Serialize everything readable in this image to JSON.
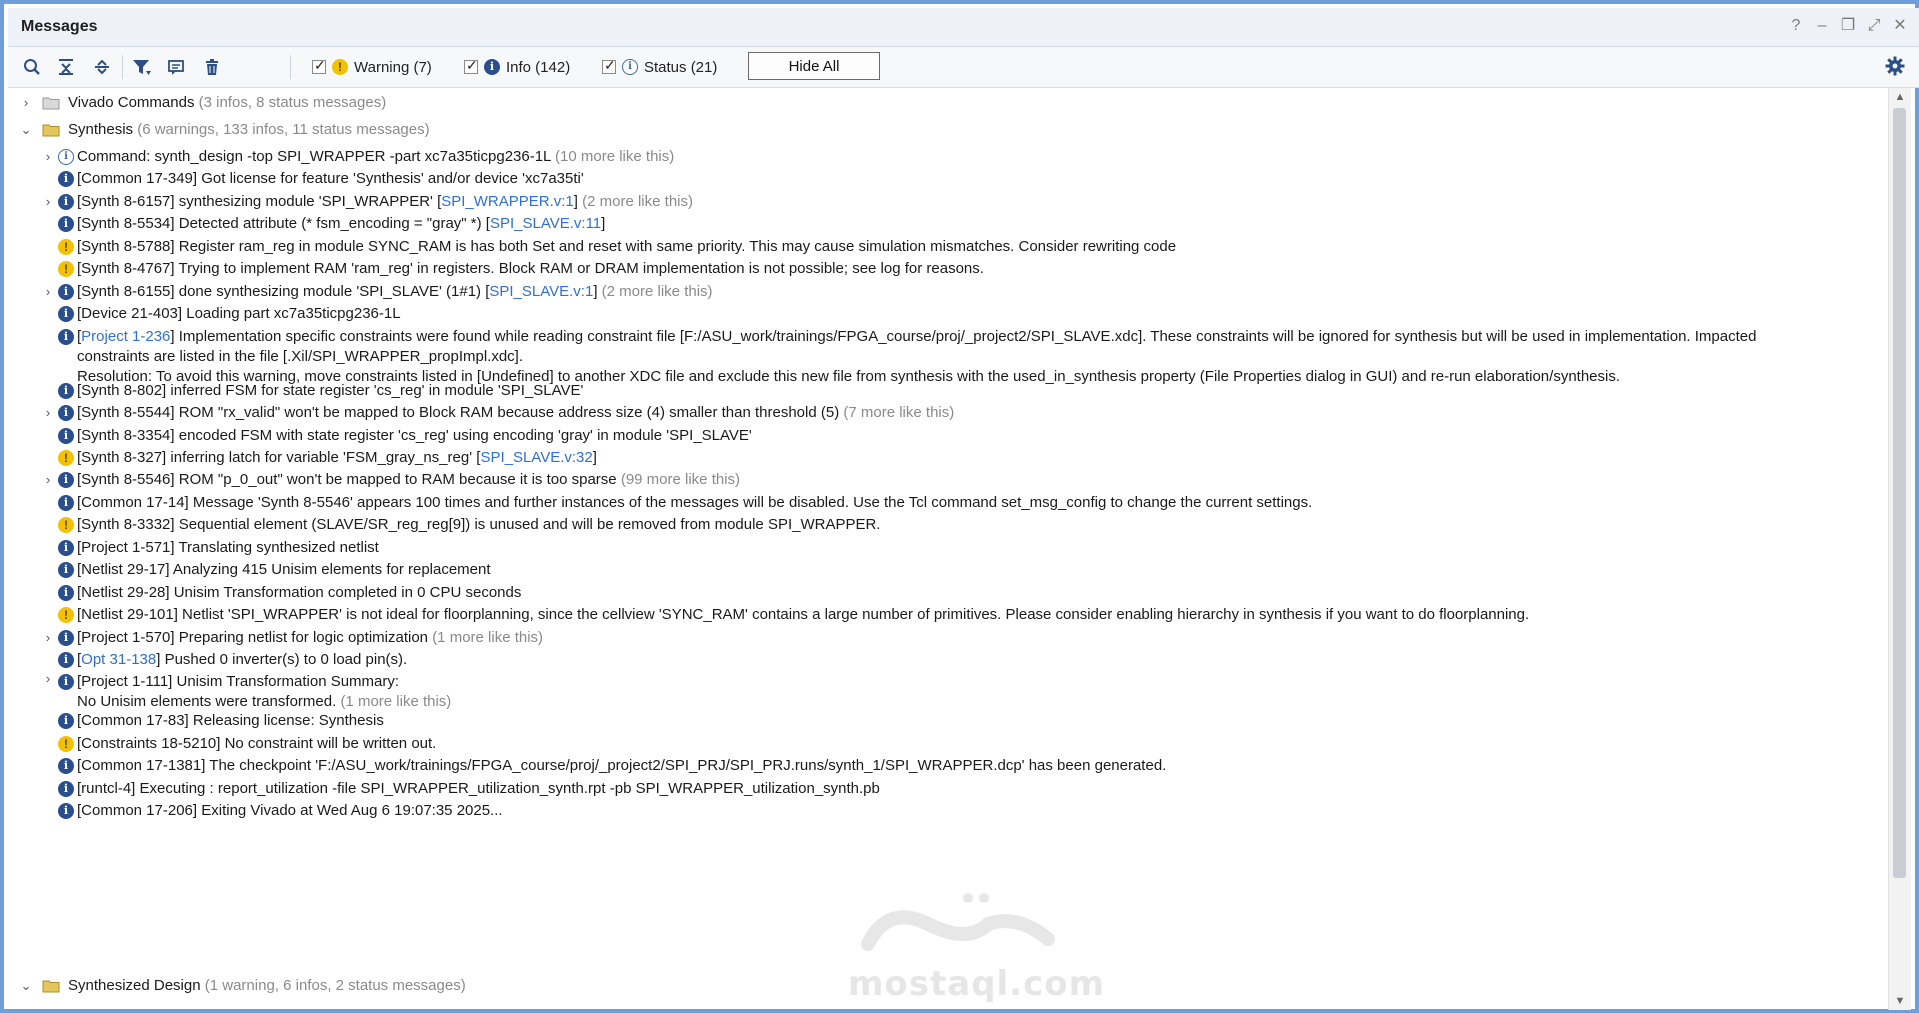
{
  "window": {
    "title": "Messages",
    "controls": [
      "?",
      "–",
      "❐",
      "⤢",
      "✕"
    ]
  },
  "toolbar": {
    "filters": [
      {
        "type": "warning",
        "label": "Warning (7)"
      },
      {
        "type": "info",
        "label": "Info (142)"
      },
      {
        "type": "status",
        "label": "Status (21)"
      }
    ],
    "hide_all_label": "Hide All"
  },
  "groups": {
    "vivado": {
      "name": "Vivado Commands",
      "summary": "(3 infos, 8 status messages)"
    },
    "synthesis": {
      "name": "Synthesis",
      "summary": "(6 warnings, 133 infos, 11 status messages)"
    },
    "synth_design": {
      "name": "Synthesized Design",
      "summary": "(1 warning, 6 infos, 2 status messages)"
    }
  },
  "messages": [
    {
      "icon": "status",
      "expand": true,
      "text": "Command: synth_design -top SPI_WRAPPER -part xc7a35ticpg236-1L",
      "more": "(10 more like this)"
    },
    {
      "icon": "info",
      "text": "[Common 17-349] Got license for feature 'Synthesis' and/or device 'xc7a35ti'"
    },
    {
      "icon": "info",
      "expand": true,
      "text": "[Synth 8-6157] synthesizing module 'SPI_WRAPPER' [",
      "link": "SPI_WRAPPER.v:1",
      "after": "]",
      "more": "(2 more like this)"
    },
    {
      "icon": "info",
      "text": "[Synth 8-5534] Detected attribute (* fsm_encoding = \"gray\" *) [",
      "link": "SPI_SLAVE.v:11",
      "after": "]"
    },
    {
      "icon": "warning",
      "text": "[Synth 8-5788] Register ram_reg in module SYNC_RAM is has both Set and reset with same priority. This may cause simulation mismatches. Consider rewriting code"
    },
    {
      "icon": "warning",
      "text": "[Synth 8-4767] Trying to implement RAM 'ram_reg' in registers. Block RAM or DRAM implementation is not possible; see log for reasons."
    },
    {
      "icon": "info",
      "expand": true,
      "text": "[Synth 8-6155] done synthesizing module 'SPI_SLAVE' (1#1) [",
      "link": "SPI_SLAVE.v:1",
      "after": "]",
      "more": "(2 more like this)"
    },
    {
      "icon": "info",
      "text": "[Device 21-403] Loading part xc7a35ticpg236-1L"
    },
    {
      "icon": "info",
      "multi": true,
      "link_first": "Project 1-236",
      "text": "Implementation specific constraints were found while reading constraint file [F:/ASU_work/trainings/FPGA_course/proj/_project2/SPI_SLAVE.xdc]. These constraints will be ignored for synthesis but will be used in implementation. Impacted",
      "line2": "constraints are listed in the file [.Xil/SPI_WRAPPER_propImpl.xdc].",
      "line3": "Resolution: To avoid this warning, move constraints listed in [Undefined] to another XDC file and exclude this new file from synthesis with the used_in_synthesis property (File Properties dialog in GUI) and re-run elaboration/synthesis."
    },
    {
      "icon": "info",
      "text": "[Synth 8-802] inferred FSM for state register 'cs_reg' in module 'SPI_SLAVE'"
    },
    {
      "icon": "info",
      "expand": true,
      "text": "[Synth 8-5544] ROM \"rx_valid\" won't be mapped to Block RAM because address size (4) smaller than threshold (5)",
      "more": "(7 more like this)"
    },
    {
      "icon": "info",
      "text": "[Synth 8-3354] encoded FSM with state register 'cs_reg' using encoding 'gray' in module 'SPI_SLAVE'"
    },
    {
      "icon": "warning",
      "text": "[Synth 8-327] inferring latch for variable 'FSM_gray_ns_reg' [",
      "link": "SPI_SLAVE.v:32",
      "after": "]"
    },
    {
      "icon": "info",
      "expand": true,
      "text": "[Synth 8-5546] ROM \"p_0_out\" won't be mapped to RAM because it is too sparse",
      "more": "(99 more like this)"
    },
    {
      "icon": "info",
      "text": "[Common 17-14] Message 'Synth 8-5546' appears 100 times and further instances of the messages will be disabled. Use the Tcl command set_msg_config to change the current settings."
    },
    {
      "icon": "warning",
      "text": "[Synth 8-3332] Sequential element (SLAVE/SR_reg_reg[9]) is unused and will be removed from module SPI_WRAPPER."
    },
    {
      "icon": "info",
      "text": "[Project 1-571] Translating synthesized netlist"
    },
    {
      "icon": "info",
      "text": "[Netlist 29-17] Analyzing 415 Unisim elements for replacement"
    },
    {
      "icon": "info",
      "text": "[Netlist 29-28] Unisim Transformation completed in 0 CPU seconds"
    },
    {
      "icon": "warning",
      "text": "[Netlist 29-101] Netlist 'SPI_WRAPPER' is not ideal for floorplanning, since the cellview 'SYNC_RAM' contains a large number of primitives. Please consider enabling hierarchy in synthesis if you want to do floorplanning."
    },
    {
      "icon": "info",
      "expand": true,
      "text": "[Project 1-570] Preparing netlist for logic optimization",
      "more": "(1 more like this)"
    },
    {
      "icon": "info",
      "link_first": "Opt 31-138",
      "text": "Pushed 0 inverter(s) to 0 load pin(s)."
    },
    {
      "icon": "info",
      "expand": true,
      "multi2": true,
      "text": "[Project 1-111] Unisim Transformation Summary:",
      "line2": "No Unisim elements were transformed.",
      "more": "(1 more like this)"
    },
    {
      "icon": "info",
      "text": "[Common 17-83] Releasing license: Synthesis"
    },
    {
      "icon": "warning",
      "text": "[Constraints 18-5210] No constraint will be written out."
    },
    {
      "icon": "info",
      "text": "[Common 17-1381] The checkpoint 'F:/ASU_work/trainings/FPGA_course/proj/_project2/SPI_PRJ/SPI_PRJ.runs/synth_1/SPI_WRAPPER.dcp' has been generated."
    },
    {
      "icon": "info",
      "text": "[runtcl-4] Executing : report_utilization -file SPI_WRAPPER_utilization_synth.rpt -pb SPI_WRAPPER_utilization_synth.pb"
    },
    {
      "icon": "info",
      "text": "[Common 17-206] Exiting Vivado at Wed Aug 6 19:07:35 2025..."
    }
  ],
  "watermark": {
    "text": "mostaql.com"
  },
  "colors": {
    "frame": "#6e9fd9",
    "info": "#2a4f8f",
    "warning": "#f2c200",
    "link": "#2f6fd6"
  }
}
